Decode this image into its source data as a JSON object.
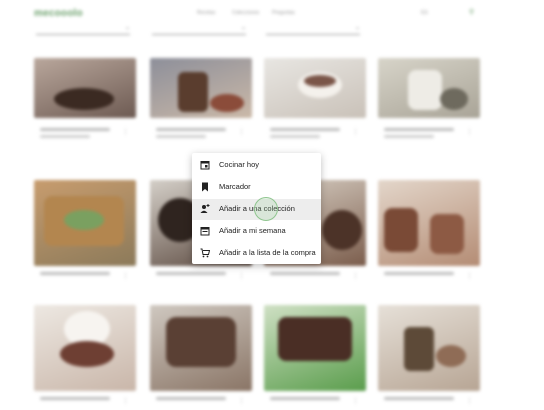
{
  "header": {
    "logo": "mecooolo",
    "nav": [
      "Recetas",
      "Colecciones",
      "Preguntas"
    ],
    "lang_label": "ES"
  },
  "colors": {
    "brand": "#6a9f6a",
    "highlight": "#ededed",
    "ripple": "#8fc58f"
  },
  "context_menu": {
    "items": [
      {
        "label": "Cocinar hoy",
        "icon": "calendar-today-icon"
      },
      {
        "label": "Marcador",
        "icon": "bookmark-icon"
      },
      {
        "label": "Añadir a una colección",
        "icon": "add-collection-icon",
        "highlighted": true
      },
      {
        "label": "Añadir a mi semana",
        "icon": "calendar-week-icon"
      },
      {
        "label": "Añadir a la lista de la compra",
        "icon": "add-cart-icon"
      }
    ]
  },
  "recipe_cards": [
    {
      "icon": "recipe-image"
    },
    {
      "icon": "recipe-image"
    },
    {
      "icon": "recipe-image"
    },
    {
      "icon": "recipe-image"
    },
    {
      "icon": "recipe-image"
    },
    {
      "icon": "recipe-image"
    },
    {
      "icon": "recipe-image"
    },
    {
      "icon": "recipe-image"
    },
    {
      "icon": "recipe-image"
    },
    {
      "icon": "recipe-image"
    },
    {
      "icon": "recipe-image"
    },
    {
      "icon": "recipe-image"
    }
  ]
}
